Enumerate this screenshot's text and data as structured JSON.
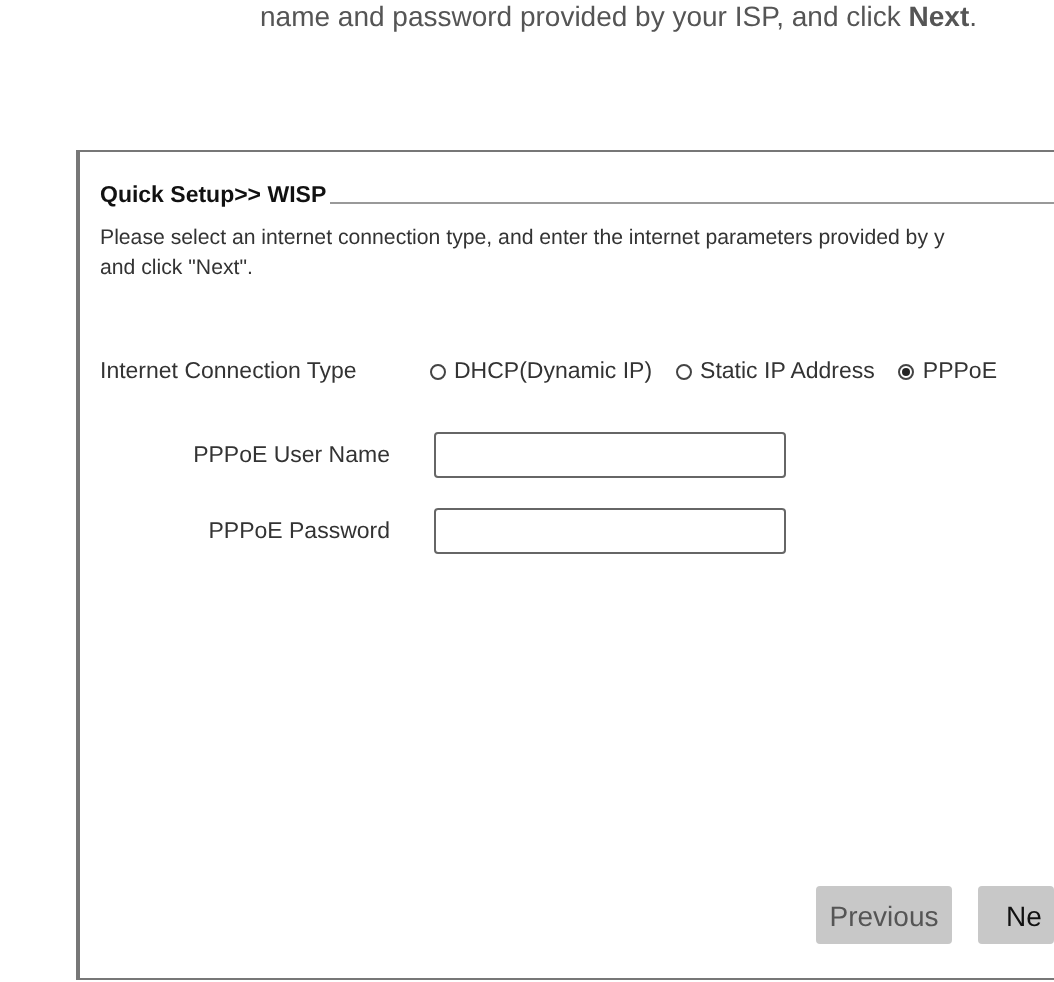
{
  "intro": "name and password provided by your ISP, and click **Next**.",
  "panel": {
    "title": "Quick Setup>> WISP",
    "description": [
      "Please select an internet connection type, and enter the internet parameters provided by y",
      "and click \"Next\"."
    ],
    "connection_type": {
      "label": "Internet Connection Type",
      "options": [
        {
          "label": "DHCP(Dynamic IP)",
          "selected": false
        },
        {
          "label": "Static IP Address",
          "selected": false
        },
        {
          "label": "PPPoE",
          "selected": true
        }
      ]
    },
    "fields": [
      {
        "label": "PPPoE User Name"
      },
      {
        "label": "PPPoE Password"
      }
    ],
    "buttons": [
      "Previous",
      "Ne"
    ]
  }
}
